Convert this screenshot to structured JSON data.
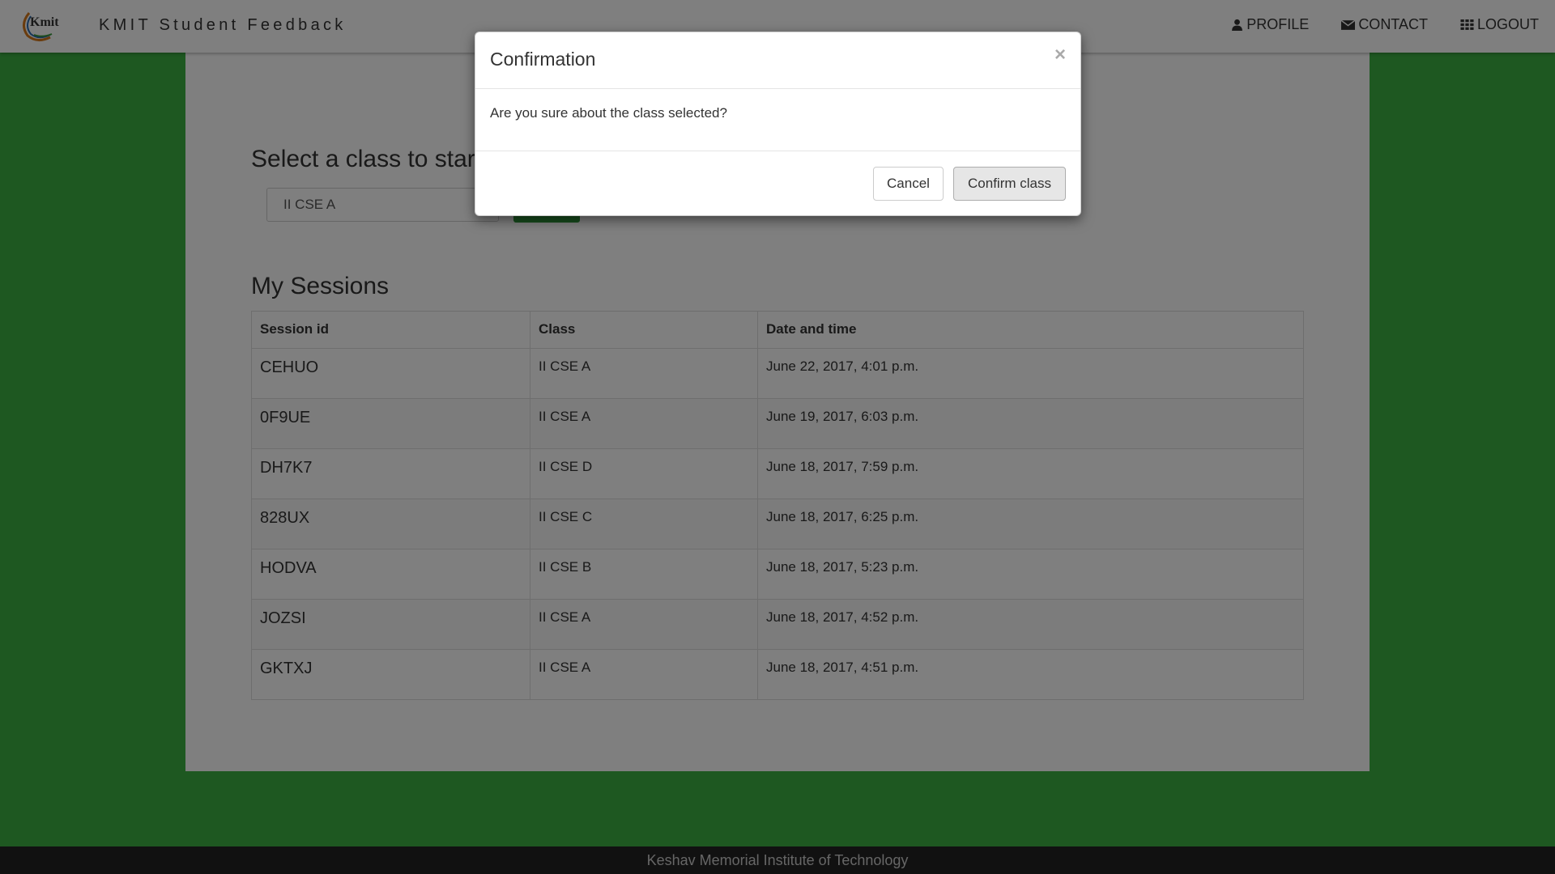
{
  "navbar": {
    "logo_text": "Kmit",
    "brand": "KMIT Student Feedback",
    "links": [
      {
        "label": "PROFILE",
        "icon": "user-icon"
      },
      {
        "label": "CONTACT",
        "icon": "envelope-icon"
      },
      {
        "label": "LOGOUT",
        "icon": "grid-icon"
      }
    ]
  },
  "main": {
    "select_heading": "Select a class to star",
    "class_select_value": "II CSE A",
    "sessions_title": "My Sessions",
    "table": {
      "headers": [
        "Session id",
        "Class",
        "Date and time"
      ],
      "rows": [
        [
          "CEHUO",
          "II CSE A",
          "June 22, 2017, 4:01 p.m."
        ],
        [
          "0F9UE",
          "II CSE A",
          "June 19, 2017, 6:03 p.m."
        ],
        [
          "DH7K7",
          "II CSE D",
          "June 18, 2017, 7:59 p.m."
        ],
        [
          "828UX",
          "II CSE C",
          "June 18, 2017, 6:25 p.m."
        ],
        [
          "HODVA",
          "II CSE B",
          "June 18, 2017, 5:23 p.m."
        ],
        [
          "JOZSI",
          "II CSE A",
          "June 18, 2017, 4:52 p.m."
        ],
        [
          "GKTXJ",
          "II CSE A",
          "June 18, 2017, 4:51 p.m."
        ]
      ]
    }
  },
  "modal": {
    "title": "Confirmation",
    "close_glyph": "×",
    "body": "Are you sure about the class selected?",
    "cancel_label": "Cancel",
    "confirm_label": "Confirm class"
  },
  "footer": {
    "text": "Keshav Memorial Institute of Technology"
  },
  "colors": {
    "page_background": "#3cb043",
    "backdrop": "rgba(0,0,0,0.5)",
    "footer_background": "#222222"
  }
}
